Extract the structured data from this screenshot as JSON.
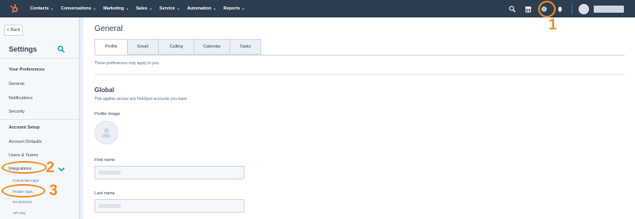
{
  "topnav": {
    "items": [
      {
        "label": "Contacts"
      },
      {
        "label": "Conversations"
      },
      {
        "label": "Marketing"
      },
      {
        "label": "Sales"
      },
      {
        "label": "Service"
      },
      {
        "label": "Automation"
      },
      {
        "label": "Reports"
      }
    ],
    "chevron": "⌄",
    "icons": [
      "search-icon",
      "marketplace-icon",
      "gear-icon",
      "bell-icon"
    ],
    "background": "#2d3e50"
  },
  "sidebar": {
    "back_label": "< Back",
    "title": "Settings",
    "sections": [
      {
        "heading": "Your Preferences",
        "items": [
          "General",
          "Notifications",
          "Security"
        ]
      },
      {
        "heading": "Account Setup",
        "items": [
          "Account Defaults",
          "Users & Teams",
          "Integrations"
        ]
      }
    ],
    "subitems": [
      "Connected Apps",
      "Private Apps",
      "Ecommerce",
      "API Key"
    ]
  },
  "main": {
    "title": "General",
    "tabs": [
      {
        "label": "Profile",
        "active": true
      },
      {
        "label": "Email"
      },
      {
        "label": "Calling"
      },
      {
        "label": "Calendar"
      },
      {
        "label": "Tasks"
      }
    ],
    "note": "These preferences only apply to you.",
    "global": {
      "title": "Global",
      "description": "This applies across any HubSpot accounts you have."
    },
    "fields": {
      "profile_image_label": "Profile Image",
      "first_name_label": "First name",
      "last_name_label": "Last name"
    }
  },
  "annotations": [
    {
      "number": "1",
      "target": "gear-icon"
    },
    {
      "number": "2",
      "target": "sidebar-item-integrations"
    },
    {
      "number": "3",
      "target": "sidebar-subitem-private-apps"
    }
  ],
  "colors": {
    "accent": "#f28c28",
    "sidebar_bg": "#f5f8fa",
    "text": "#33475b"
  }
}
